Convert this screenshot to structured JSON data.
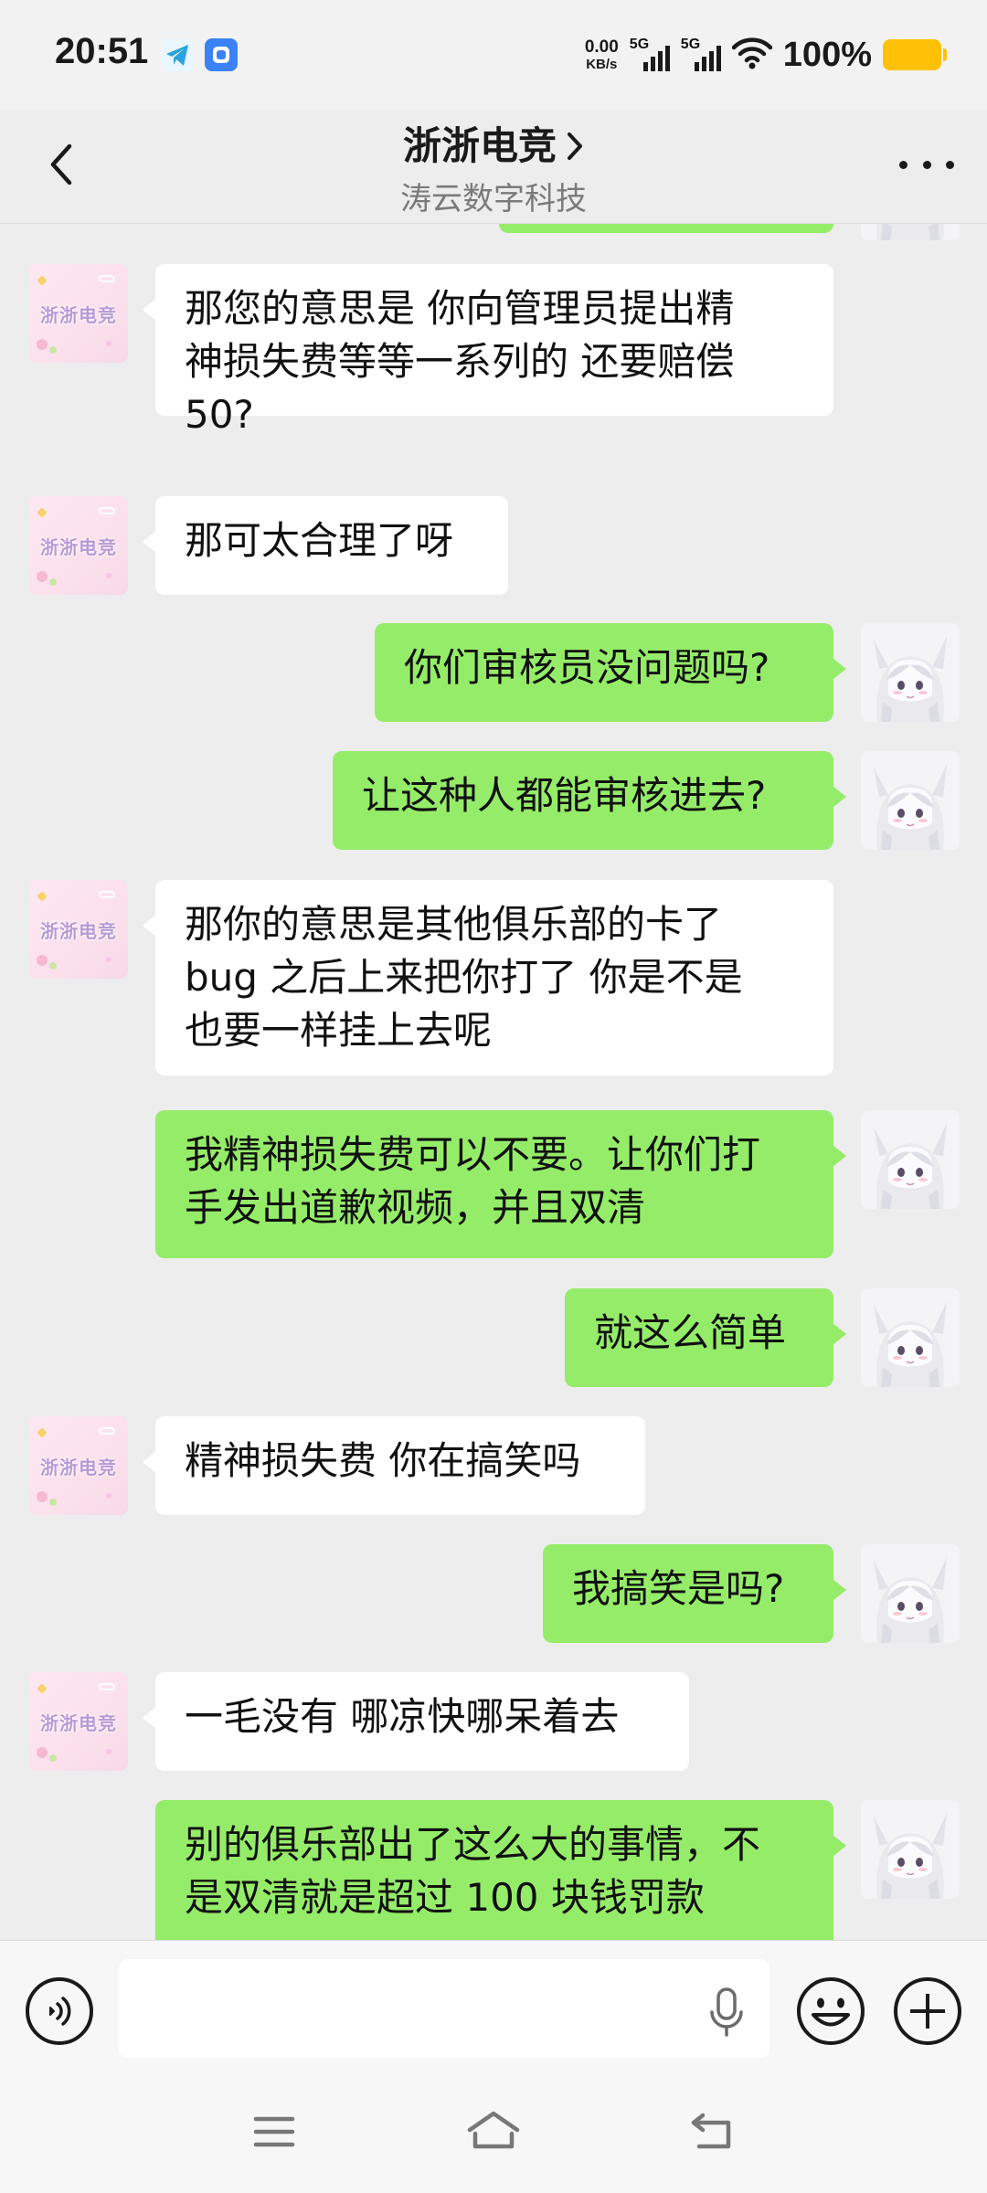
{
  "status_bar": {
    "time": "20:51",
    "net_speed_value": "0.00",
    "net_speed_unit": "KB/s",
    "sim1_label": "5G",
    "sim2_label": "5G",
    "battery_percent": "100%",
    "battery_color": "#ffc107"
  },
  "header": {
    "title": "浙浙电竞",
    "subtitle": "涛云数字科技"
  },
  "avatars": {
    "club_label": "浙浙电竞"
  },
  "messages": [
    {
      "from": "them",
      "text": "那您的意思是 你向管理员提出精\n神损失费等等一系列的 还要赔偿\n50?"
    },
    {
      "from": "them",
      "text": "那可太合理了呀"
    },
    {
      "from": "me",
      "text": "你们审核员没问题吗?"
    },
    {
      "from": "me",
      "text": "让这种人都能审核进去?"
    },
    {
      "from": "them",
      "text": "那你的意思是其他俱乐部的卡了\nbug 之后上来把你打了 你是不是\n也要一样挂上去呢"
    },
    {
      "from": "me",
      "text": "我精神损失费可以不要。让你们打\n手发出道歉视频，并且双清"
    },
    {
      "from": "me",
      "text": "就这么简单"
    },
    {
      "from": "them",
      "text": "精神损失费 你在搞笑吗"
    },
    {
      "from": "me",
      "text": "我搞笑是吗?"
    },
    {
      "from": "them",
      "text": "一毛没有 哪凉快哪呆着去"
    },
    {
      "from": "me",
      "text": "别的俱乐部出了这么大的事情，不\n是双清就是超过 100 块钱罚款"
    }
  ],
  "input": {
    "value": "",
    "placeholder": ""
  },
  "colors": {
    "outgoing_bubble": "#95ec69",
    "incoming_bubble": "#ffffff",
    "chat_background": "#ededed"
  },
  "icons": {
    "back": "chevron-left-icon",
    "title_more": "chevron-right-icon",
    "menu": "more-dots-icon",
    "voice": "voice-icon",
    "mic": "mic-icon",
    "emoji": "emoji-icon",
    "plus": "plus-icon",
    "nav_menu": "menu-icon",
    "nav_home": "home-icon",
    "nav_back": "back-icon"
  }
}
